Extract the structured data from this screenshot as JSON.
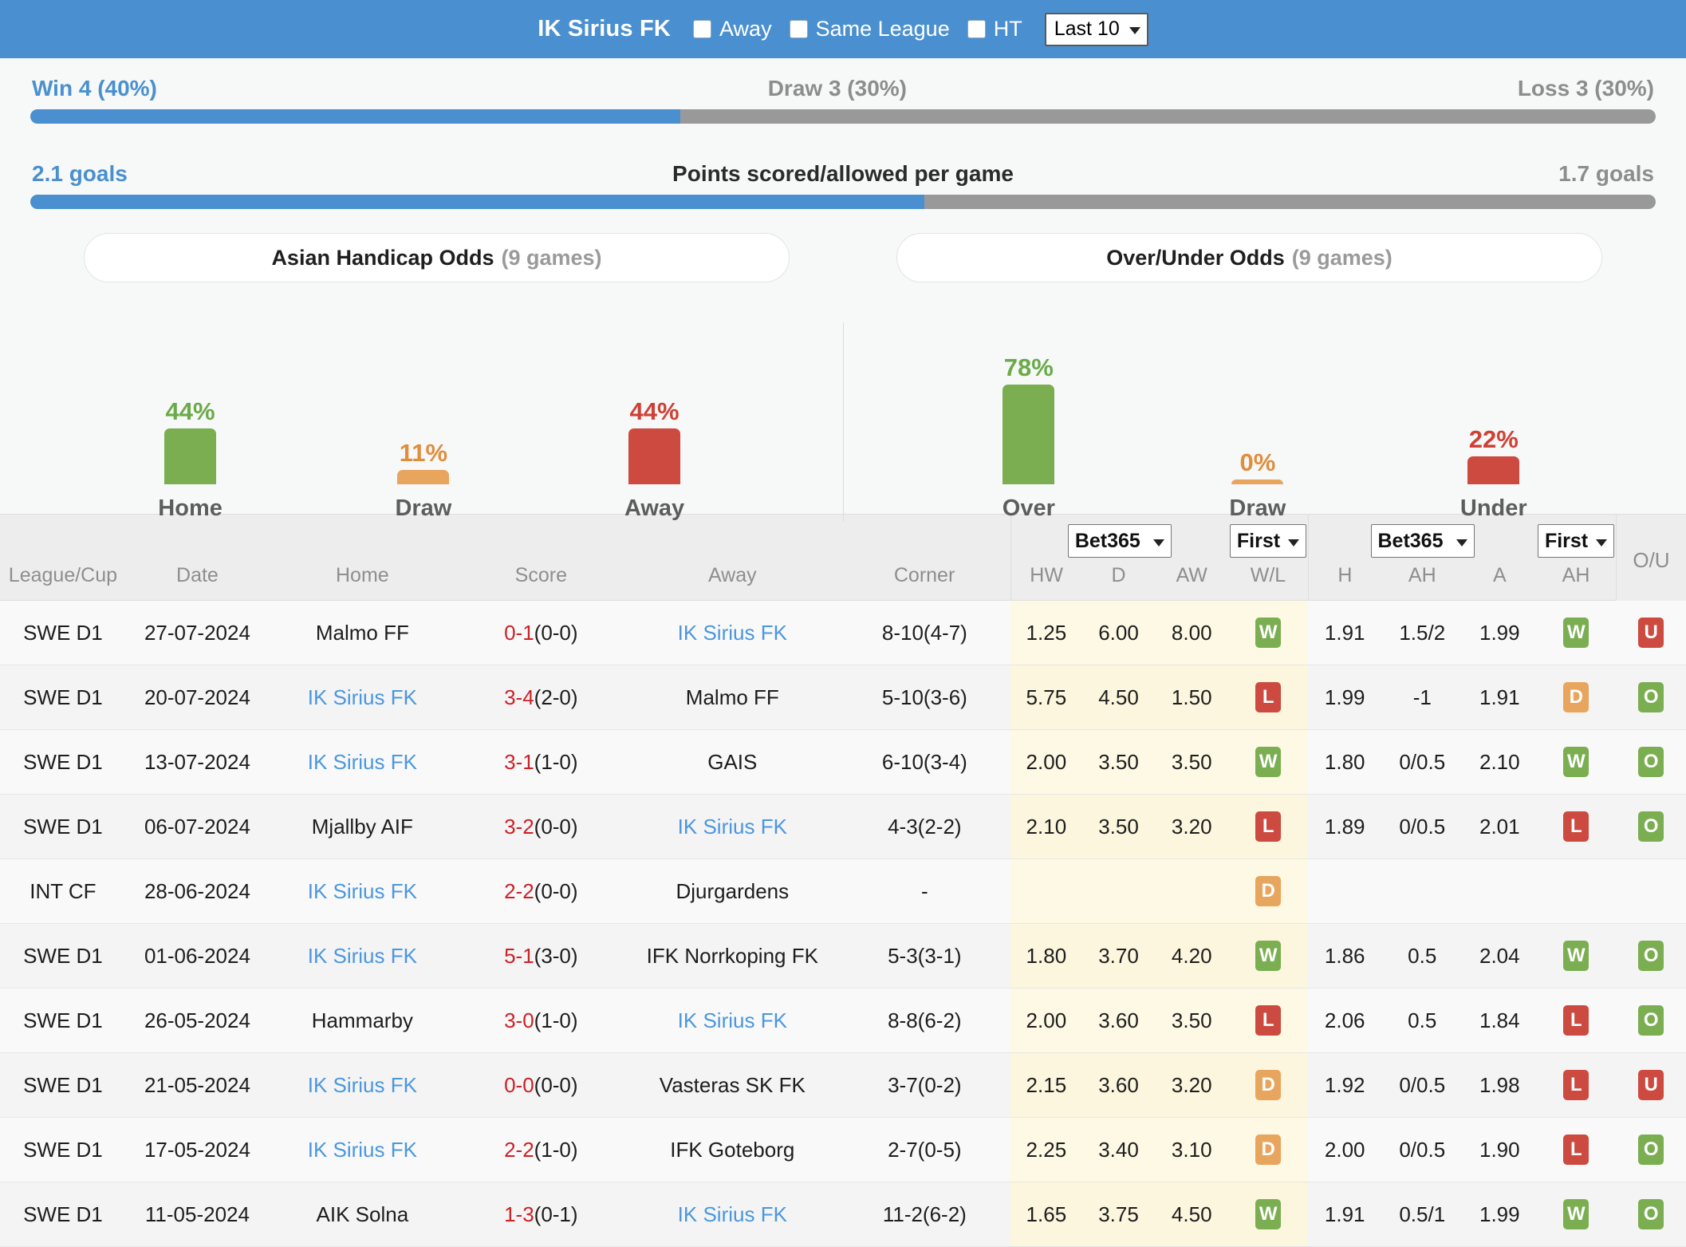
{
  "header": {
    "team": "IK Sirius FK",
    "filters": [
      {
        "label": "Away",
        "checked": false
      },
      {
        "label": "Same League",
        "checked": false
      },
      {
        "label": "HT",
        "checked": false
      }
    ],
    "range_select": {
      "value": "Last 10"
    }
  },
  "summary": {
    "row1": {
      "left": "Win 4 (40%)",
      "center": "Draw 3 (30%)",
      "right": "Loss 3 (30%)",
      "fill_percent": 40
    },
    "row2": {
      "left": "2.1 goals",
      "center": "Points scored/allowed per game",
      "right": "1.7 goals",
      "fill_percent": 55
    }
  },
  "tabs": {
    "asian": {
      "label": "Asian Handicap Odds",
      "games": "(9 games)"
    },
    "overunder": {
      "label": "Over/Under Odds",
      "games": "(9 games)"
    }
  },
  "chart_data": [
    {
      "type": "bar",
      "title": "Asian Handicap Odds",
      "categories": [
        "Home",
        "Draw",
        "Away"
      ],
      "values": [
        44,
        11,
        44
      ],
      "labels": [
        "44%",
        "11%",
        "44%"
      ],
      "colors": [
        "#7aae51",
        "#e8a55d",
        "#cc4a3f"
      ],
      "ylabel": "%",
      "ylim": [
        0,
        100
      ]
    },
    {
      "type": "bar",
      "title": "Over/Under Odds",
      "categories": [
        "Over",
        "Draw",
        "Under"
      ],
      "values": [
        78,
        0,
        22
      ],
      "labels": [
        "78%",
        "0%",
        "22%"
      ],
      "colors": [
        "#7aae51",
        "#e8a55d",
        "#cc4a3f"
      ],
      "ylabel": "%",
      "ylim": [
        0,
        100
      ]
    }
  ],
  "table": {
    "columns": [
      "League/Cup",
      "Date",
      "Home",
      "Score",
      "Away",
      "Corner"
    ],
    "group_1x2": {
      "bookmaker_select": "Bet365",
      "period_select": "First",
      "subcolumns": [
        "HW",
        "D",
        "AW",
        "W/L"
      ]
    },
    "group_ah": {
      "bookmaker_select": "Bet365",
      "period_select": "First",
      "subcolumns": [
        "H",
        "AH",
        "A",
        "AH"
      ]
    },
    "ou_column": "O/U",
    "rows": [
      {
        "league": "SWE D1",
        "date": "27-07-2024",
        "home": "Malmo FF",
        "home_highlight": false,
        "score": "0-1",
        "score_ht": "(0-0)",
        "away": "IK Sirius FK",
        "away_highlight": true,
        "corner": "8-10(4-7)",
        "hw": "1.25",
        "d": "6.00",
        "aw": "8.00",
        "wl": "W",
        "h": "1.91",
        "ah": "1.5/2",
        "a": "1.99",
        "ah_res": "W",
        "ou": "U"
      },
      {
        "league": "SWE D1",
        "date": "20-07-2024",
        "home": "IK Sirius FK",
        "home_highlight": true,
        "score": "3-4",
        "score_ht": "(2-0)",
        "away": "Malmo FF",
        "away_highlight": false,
        "corner": "5-10(3-6)",
        "hw": "5.75",
        "d": "4.50",
        "aw": "1.50",
        "wl": "L",
        "h": "1.99",
        "ah": "-1",
        "a": "1.91",
        "ah_res": "D",
        "ou": "O"
      },
      {
        "league": "SWE D1",
        "date": "13-07-2024",
        "home": "IK Sirius FK",
        "home_highlight": true,
        "score": "3-1",
        "score_ht": "(1-0)",
        "away": "GAIS",
        "away_highlight": false,
        "corner": "6-10(3-4)",
        "hw": "2.00",
        "d": "3.50",
        "aw": "3.50",
        "wl": "W",
        "h": "1.80",
        "ah": "0/0.5",
        "a": "2.10",
        "ah_res": "W",
        "ou": "O"
      },
      {
        "league": "SWE D1",
        "date": "06-07-2024",
        "home": "Mjallby AIF",
        "home_highlight": false,
        "score": "3-2",
        "score_ht": "(0-0)",
        "away": "IK Sirius FK",
        "away_highlight": true,
        "corner": "4-3(2-2)",
        "hw": "2.10",
        "d": "3.50",
        "aw": "3.20",
        "wl": "L",
        "h": "1.89",
        "ah": "0/0.5",
        "a": "2.01",
        "ah_res": "L",
        "ou": "O"
      },
      {
        "league": "INT CF",
        "date": "28-06-2024",
        "home": "IK Sirius FK",
        "home_highlight": true,
        "score": "2-2",
        "score_ht": "(0-0)",
        "away": "Djurgardens",
        "away_highlight": false,
        "corner": "-",
        "hw": "",
        "d": "",
        "aw": "",
        "wl": "D",
        "h": "",
        "ah": "",
        "a": "",
        "ah_res": "",
        "ou": ""
      },
      {
        "league": "SWE D1",
        "date": "01-06-2024",
        "home": "IK Sirius FK",
        "home_highlight": true,
        "score": "5-1",
        "score_ht": "(3-0)",
        "away": "IFK Norrkoping FK",
        "away_highlight": false,
        "corner": "5-3(3-1)",
        "hw": "1.80",
        "d": "3.70",
        "aw": "4.20",
        "wl": "W",
        "h": "1.86",
        "ah": "0.5",
        "a": "2.04",
        "ah_res": "W",
        "ou": "O"
      },
      {
        "league": "SWE D1",
        "date": "26-05-2024",
        "home": "Hammarby",
        "home_highlight": false,
        "score": "3-0",
        "score_ht": "(1-0)",
        "away": "IK Sirius FK",
        "away_highlight": true,
        "corner": "8-8(6-2)",
        "hw": "2.00",
        "d": "3.60",
        "aw": "3.50",
        "wl": "L",
        "h": "2.06",
        "ah": "0.5",
        "a": "1.84",
        "ah_res": "L",
        "ou": "O"
      },
      {
        "league": "SWE D1",
        "date": "21-05-2024",
        "home": "IK Sirius FK",
        "home_highlight": true,
        "score": "0-0",
        "score_ht": "(0-0)",
        "away": "Vasteras SK FK",
        "away_highlight": false,
        "corner": "3-7(0-2)",
        "hw": "2.15",
        "d": "3.60",
        "aw": "3.20",
        "wl": "D",
        "h": "1.92",
        "ah": "0/0.5",
        "a": "1.98",
        "ah_res": "L",
        "ou": "U"
      },
      {
        "league": "SWE D1",
        "date": "17-05-2024",
        "home": "IK Sirius FK",
        "home_highlight": true,
        "score": "2-2",
        "score_ht": "(1-0)",
        "away": "IFK Goteborg",
        "away_highlight": false,
        "corner": "2-7(0-5)",
        "hw": "2.25",
        "d": "3.40",
        "aw": "3.10",
        "wl": "D",
        "h": "2.00",
        "ah": "0/0.5",
        "a": "1.90",
        "ah_res": "L",
        "ou": "O"
      },
      {
        "league": "SWE D1",
        "date": "11-05-2024",
        "home": "AIK Solna",
        "home_highlight": false,
        "score": "1-3",
        "score_ht": "(0-1)",
        "away": "IK Sirius FK",
        "away_highlight": true,
        "corner": "11-2(6-2)",
        "hw": "1.65",
        "d": "3.75",
        "aw": "4.50",
        "wl": "W",
        "h": "1.91",
        "ah": "0.5/1",
        "a": "1.99",
        "ah_res": "W",
        "ou": "O"
      }
    ]
  },
  "colors": {
    "brand_blue": "#4a90d0",
    "gray": "#999999",
    "green": "#7aae51",
    "orange": "#e8a55d",
    "red": "#cc4a3f",
    "link": "#4a97e0",
    "score_red": "#cc2026"
  }
}
